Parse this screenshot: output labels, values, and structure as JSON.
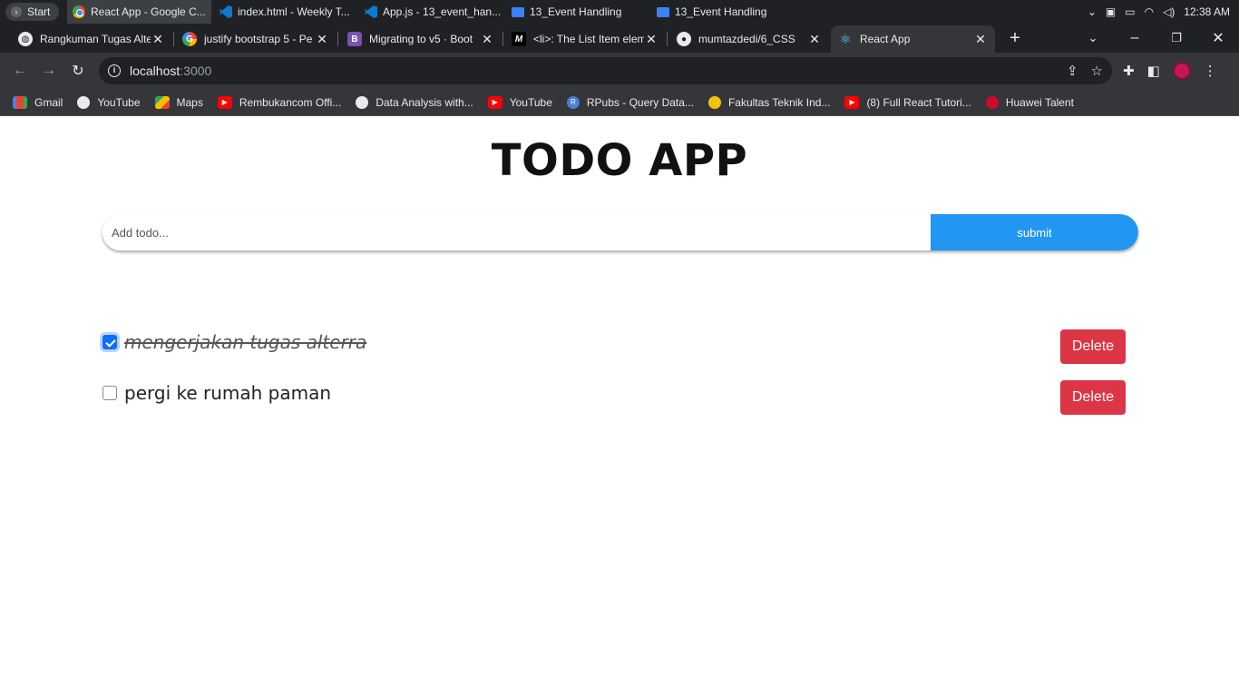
{
  "taskbar": {
    "start_label": "Start",
    "items": [
      {
        "label": "React App - Google C...",
        "icon": "chrome-icon"
      },
      {
        "label": "index.html - Weekly T...",
        "icon": "vscode-icon"
      },
      {
        "label": "App.js - 13_event_han...",
        "icon": "vscode-icon"
      },
      {
        "label": "13_Event Handling",
        "icon": "folder-icon"
      },
      {
        "label": "13_Event Handling",
        "icon": "folder-icon"
      }
    ],
    "clock": "12:38 AM"
  },
  "tabs": [
    {
      "title": "Rangkuman Tugas Alte",
      "icon": "globe-icon"
    },
    {
      "title": "justify bootstrap 5 - Pe",
      "icon": "google-icon"
    },
    {
      "title": "Migrating to v5 · Boot",
      "icon": "bootstrap-icon"
    },
    {
      "title": "<li>: The List Item elem",
      "icon": "mdn-icon"
    },
    {
      "title": "mumtazdedi/6_CSS",
      "icon": "github-icon"
    },
    {
      "title": "React App",
      "icon": "react-icon"
    }
  ],
  "address_bar": {
    "host": "localhost",
    "port": ":3000"
  },
  "bookmarks": [
    {
      "label": "Gmail",
      "icon": "gmail-icon"
    },
    {
      "label": "YouTube",
      "icon": "globe-icon"
    },
    {
      "label": "Maps",
      "icon": "maps-icon"
    },
    {
      "label": "Rembukancom Offi...",
      "icon": "youtube-icon"
    },
    {
      "label": "Data Analysis with...",
      "icon": "globe-icon"
    },
    {
      "label": "YouTube",
      "icon": "youtube-icon"
    },
    {
      "label": "RPubs - Query Data...",
      "icon": "rpubs-icon"
    },
    {
      "label": "Fakultas Teknik Ind...",
      "icon": "university-icon"
    },
    {
      "label": "(8) Full React Tutori...",
      "icon": "youtube-icon"
    },
    {
      "label": "Huawei Talent",
      "icon": "huawei-icon"
    }
  ],
  "app": {
    "title": "TODO APP",
    "input_placeholder": "Add todo...",
    "submit_label": "submit",
    "todos": [
      {
        "text": "mengerjakan tugas alterra",
        "completed": true,
        "delete_label": "Delete"
      },
      {
        "text": "pergi ke rumah paman",
        "completed": false,
        "delete_label": "Delete"
      }
    ]
  },
  "colors": {
    "submit_button": "#2196f3",
    "delete_button": "#dc3545",
    "checkbox_checked": "#0d6efd"
  }
}
